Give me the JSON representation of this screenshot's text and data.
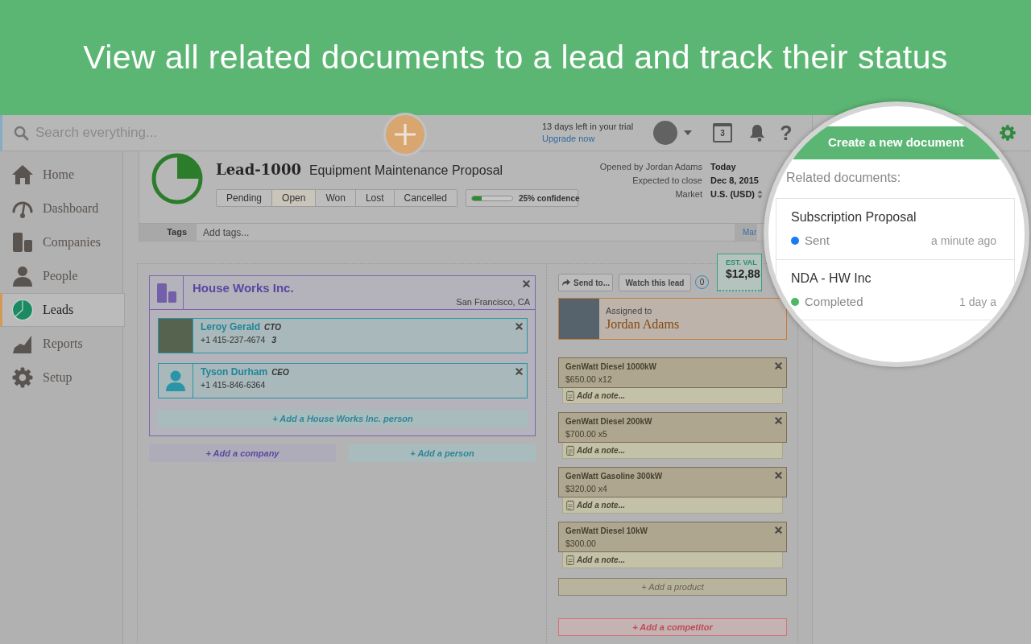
{
  "banner": {
    "title": "View all related documents to a lead and track their status"
  },
  "top_bar": {
    "search_placeholder": "Search everything...",
    "trial_notice": "13 days left in your trial",
    "upgrade_link": "Upgrade now",
    "calendar_day": "3",
    "help_label": "?"
  },
  "sidebar": {
    "items": [
      {
        "label": "Home",
        "selected": false
      },
      {
        "label": "Dashboard",
        "selected": false
      },
      {
        "label": "Companies",
        "selected": false
      },
      {
        "label": "People",
        "selected": false
      },
      {
        "label": "Leads",
        "selected": true
      },
      {
        "label": "Reports",
        "selected": false
      },
      {
        "label": "Setup",
        "selected": false
      }
    ]
  },
  "lead": {
    "number": "Lead-1000",
    "title": "Equipment Maintenance Proposal",
    "statuses": [
      {
        "label": "Pending",
        "selected": false
      },
      {
        "label": "Open",
        "selected": true
      },
      {
        "label": "Won",
        "selected": false
      },
      {
        "label": "Lost",
        "selected": false
      },
      {
        "label": "Cancelled",
        "selected": false
      }
    ],
    "confidence": {
      "level": 0.25,
      "label": "25% confidence"
    },
    "details": [
      {
        "kind": "text",
        "label": "Opened by Jordan Adams",
        "value": "Today"
      },
      {
        "kind": "text",
        "label": "Expected to close",
        "value": "Dec 8, 2015"
      },
      {
        "kind": "select",
        "label": "Market",
        "value": "U.S. (USD)"
      }
    ],
    "tags": {
      "label": "Tags",
      "placeholder": "Add tags...",
      "link": "Mar"
    }
  },
  "company": {
    "name": "House Works Inc.",
    "location": "San Francisco, CA",
    "people": [
      {
        "kind": "photo",
        "name": "Leroy Gerald",
        "role": "CTO",
        "phone": "+1 415-237-4674",
        "suffix": "3"
      },
      {
        "kind": "silhouette",
        "name": "Tyson Durham",
        "role": "CEO",
        "phone": "+1 415-846-6364"
      }
    ],
    "add_person": "+ Add a House Works Inc. person"
  },
  "add_company": "+ Add a company",
  "add_person": "+ Add a person",
  "actions": {
    "send": "Send to...",
    "watch": "Watch this lead",
    "watchers": "0"
  },
  "estimate": {
    "label": "EST. VAL",
    "value": "$12,88"
  },
  "assignee": {
    "label": "Assigned to",
    "name": "Jordan Adams"
  },
  "products": [
    {
      "name": "GenWatt Diesel 1000kW",
      "price": "$650.00 x12",
      "note_placeholder": "Add a note..."
    },
    {
      "name": "GenWatt Diesel 200kW",
      "price": "$700.00 x5",
      "note_placeholder": "Add a note..."
    },
    {
      "name": "GenWatt Gasoline 300kW",
      "price": "$320.00 x4",
      "note_placeholder": "Add a note..."
    },
    {
      "name": "GenWatt Diesel 10kW",
      "price": "$300.00",
      "note_placeholder": "Add a note..."
    }
  ],
  "add_product": "+ Add a product",
  "add_competitor": "+ Add a competitor",
  "magnifier": {
    "button": "Create a new document",
    "heading": "Related documents:",
    "documents": [
      {
        "title": "Subscription Proposal",
        "status": "Sent",
        "color": "#1a7cf5",
        "time": "a minute ago"
      },
      {
        "title": "NDA - HW Inc",
        "status": "Completed",
        "color": "#4cb860",
        "time": "1 day a"
      }
    ]
  }
}
